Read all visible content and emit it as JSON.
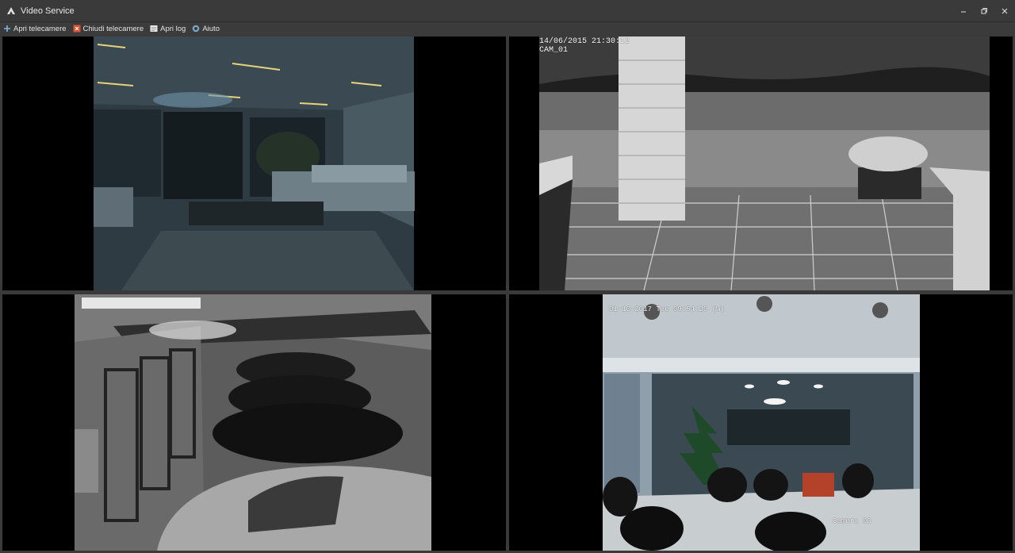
{
  "window": {
    "title": "Video Service",
    "controls": [
      "minimize",
      "restore",
      "close"
    ]
  },
  "toolbar": {
    "items": [
      {
        "label": "Apri telecamere",
        "icon": "plus-icon"
      },
      {
        "label": "Chiudi telecamere",
        "icon": "close-camera-icon"
      },
      {
        "label": "Apri log",
        "icon": "log-icon"
      },
      {
        "label": "Aiuto",
        "icon": "help-icon"
      }
    ]
  },
  "cameras": [
    {
      "id": "top-left",
      "overlay_lines": []
    },
    {
      "id": "top-right",
      "overlay_date": "14/06/2015 21:30:12",
      "overlay_name": "CAM_01"
    },
    {
      "id": "bottom-left",
      "overlay_lines": []
    },
    {
      "id": "bottom-right",
      "overlay_date": "01-10-2017 Tue 09:54:29 (W)",
      "overlay_name": "Camera 03"
    }
  ],
  "colors": {
    "titlebar": "#3a3a3a",
    "toolbar": "#3b3b3b",
    "grid_bg": "#3a3a3a"
  }
}
